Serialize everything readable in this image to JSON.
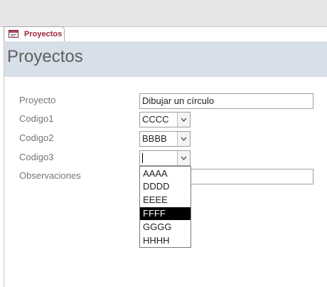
{
  "document_tab": {
    "label": "Proyectos",
    "icon": "form-icon"
  },
  "form": {
    "title": "Proyectos",
    "fields": {
      "proyecto": {
        "label": "Proyecto",
        "value": "Dibujar un círculo"
      },
      "codigo1": {
        "label": "Codigo1",
        "value": "CCCC"
      },
      "codigo2": {
        "label": "Codigo2",
        "value": "BBBB"
      },
      "codigo3": {
        "label": "Codigo3",
        "value": ""
      },
      "observaciones": {
        "label": "Observaciones",
        "value": ""
      }
    },
    "dropdown_icon": "chevron-down-icon"
  },
  "dropdown": {
    "options": [
      "AAAA",
      "DDDD",
      "EEEE",
      "FFFF",
      "GGGG",
      "HHHH"
    ],
    "selected": "FFFF"
  }
}
